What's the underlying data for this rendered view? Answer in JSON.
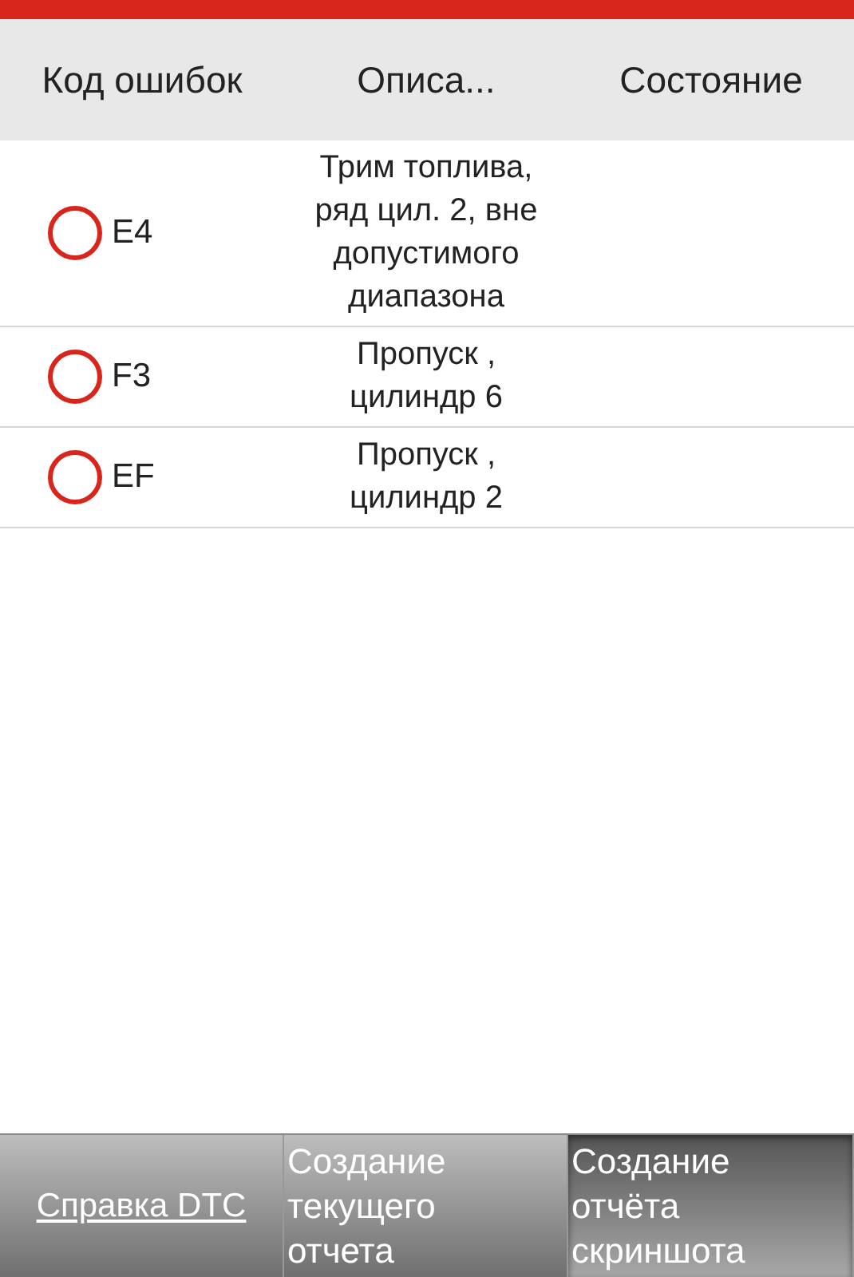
{
  "table": {
    "columns": [
      "Код ошибок",
      "Описа...",
      "Состояние"
    ],
    "rows": [
      {
        "checked": false,
        "code": "E4",
        "description": "Трим топлива, ряд цил. 2, вне допустимого диапазона"
      },
      {
        "checked": false,
        "code": "F3",
        "description": "Пропуск , цилиндр 6"
      },
      {
        "checked": false,
        "code": "EF",
        "description": "Пропуск , цилиндр 2"
      }
    ]
  },
  "buttons": [
    {
      "kind": "link",
      "label": "Справка DTC",
      "selected": false
    },
    {
      "kind": "button",
      "label": "Создание текущего отчета",
      "selected": false
    },
    {
      "kind": "button",
      "label": "Создание отчёта скриншота",
      "selected": true
    }
  ]
}
